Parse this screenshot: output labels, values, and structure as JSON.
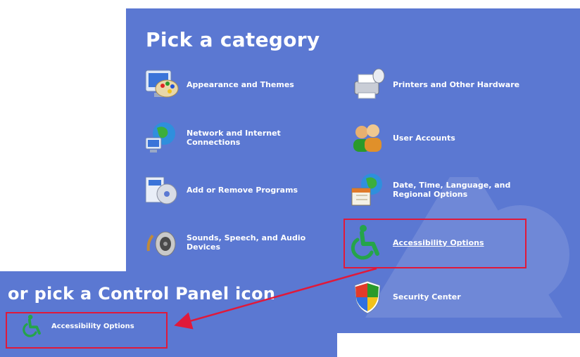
{
  "panel": {
    "title": "Pick a category"
  },
  "categories": [
    {
      "label": "Appearance and Themes",
      "icon": "appearance-themes-icon"
    },
    {
      "label": "Printers and Other Hardware",
      "icon": "printer-icon"
    },
    {
      "label": "Network and Internet Connections",
      "icon": "network-globe-icon"
    },
    {
      "label": "User Accounts",
      "icon": "user-accounts-icon"
    },
    {
      "label": "Add or Remove Programs",
      "icon": "add-remove-programs-icon"
    },
    {
      "label": "Date, Time, Language, and Regional Options",
      "icon": "date-time-globe-icon"
    },
    {
      "label": "Sounds, Speech, and Audio Devices",
      "icon": "speaker-icon"
    },
    {
      "label": "Accessibility Options",
      "icon": "wheelchair-icon"
    },
    {
      "label": "Security Center",
      "icon": "shield-icon"
    }
  ],
  "control_panel_view": {
    "title": "or pick a Control Panel icon",
    "item_label": "Accessibility Options",
    "item_icon": "wheelchair-icon"
  },
  "colors": {
    "panel_bg": "#5b78d2",
    "highlight": "#e0193a",
    "text": "#ffffff"
  }
}
